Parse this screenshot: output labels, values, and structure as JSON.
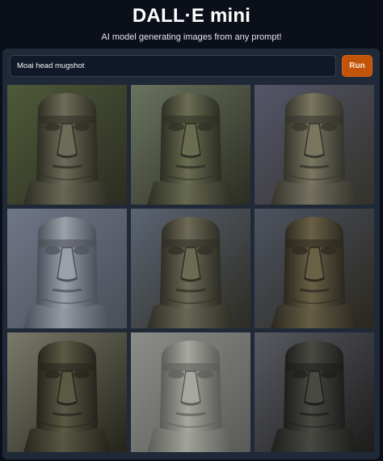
{
  "header": {
    "title": "DALL·E mini",
    "subtitle": "AI model generating images from any prompt!"
  },
  "prompt": {
    "value": "Moai head mugshot"
  },
  "run_button": {
    "label": "Run"
  },
  "colors": {
    "background": "#0b0f19",
    "panel": "#1f2937",
    "accent": "#c2540a"
  },
  "gallery": {
    "images": [
      {
        "name": "moai-image-1",
        "bg": "#4e5a38",
        "stone": "#6e6c58",
        "dark": "#2c2c22"
      },
      {
        "name": "moai-image-2",
        "bg": "#6a735f",
        "stone": "#6b6d52",
        "dark": "#2b2d22"
      },
      {
        "name": "moai-image-3",
        "bg": "#54566a",
        "stone": "#7a7760",
        "dark": "#33322a"
      },
      {
        "name": "moai-image-4",
        "bg": "#6f7686",
        "stone": "#9ca0a8",
        "dark": "#4a4e58"
      },
      {
        "name": "moai-image-5",
        "bg": "#5b6472",
        "stone": "#6d6a55",
        "dark": "#2d2c24"
      },
      {
        "name": "moai-image-6",
        "bg": "#4d5360",
        "stone": "#6a6146",
        "dark": "#2a271e"
      },
      {
        "name": "moai-image-7",
        "bg": "#7a7a6a",
        "stone": "#5b5a44",
        "dark": "#24231b"
      },
      {
        "name": "moai-image-8",
        "bg": "#8c8c88",
        "stone": "#a8a8a2",
        "dark": "#5a5a56"
      },
      {
        "name": "moai-image-9",
        "bg": "#585a62",
        "stone": "#4a4a44",
        "dark": "#1c1c1a"
      }
    ]
  }
}
